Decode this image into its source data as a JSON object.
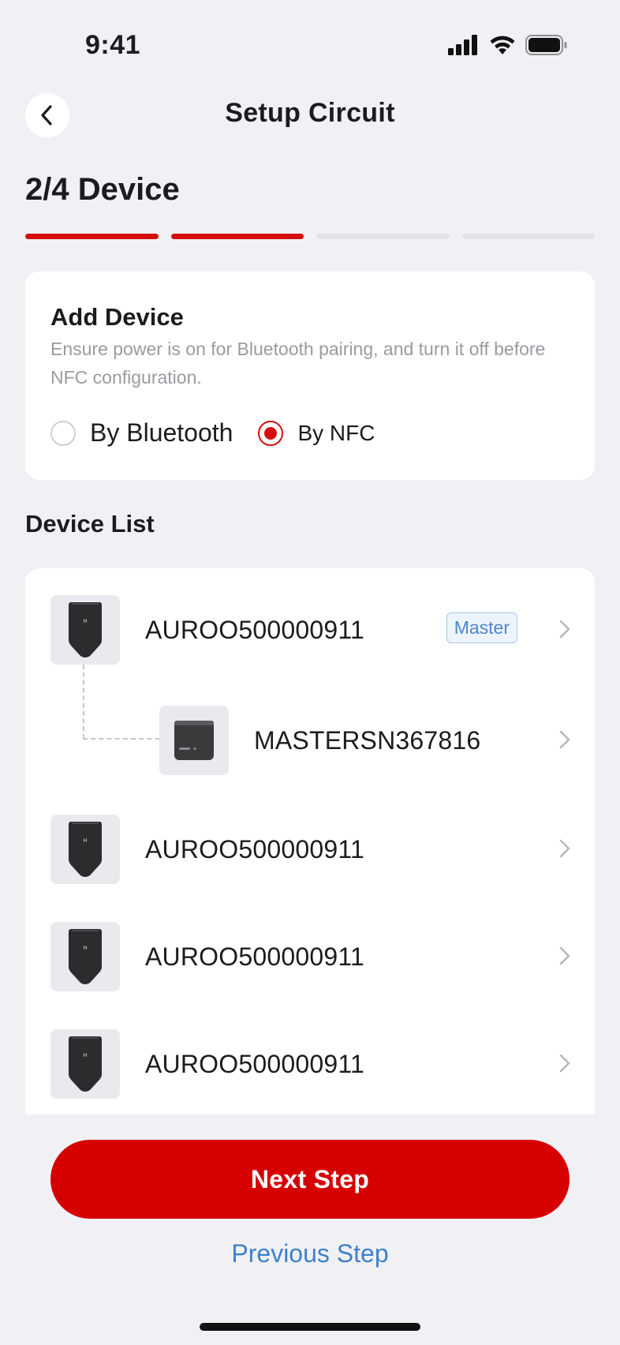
{
  "status_bar": {
    "time": "9:41",
    "icons": [
      "signal-icon",
      "wifi-icon",
      "battery-icon"
    ]
  },
  "header": {
    "title": "Setup Circuit",
    "back_icon": "chevron-left-icon"
  },
  "step": {
    "title": "2/4 Device",
    "current": 2,
    "total": 4
  },
  "add_device": {
    "title": "Add Device",
    "description": "Ensure power is on for Bluetooth pairing, and turn it off before NFC configuration.",
    "options": [
      {
        "label": "By Bluetooth",
        "selected": false
      },
      {
        "label": "By NFC",
        "selected": true
      }
    ]
  },
  "device_list": {
    "title": "Device List",
    "devices": [
      {
        "name": "AUROO500000911",
        "badge": "Master"
      },
      {
        "name": "MASTERSN367816"
      },
      {
        "name": "AUROO500000911"
      },
      {
        "name": "AUROO500000911"
      },
      {
        "name": "AUROO500000911"
      }
    ]
  },
  "footer": {
    "next_label": "Next Step",
    "previous_label": "Previous Step"
  },
  "colors": {
    "accent": "#d60000",
    "link": "#3d82cc",
    "background": "#f1f1f5",
    "card": "#ffffff"
  }
}
